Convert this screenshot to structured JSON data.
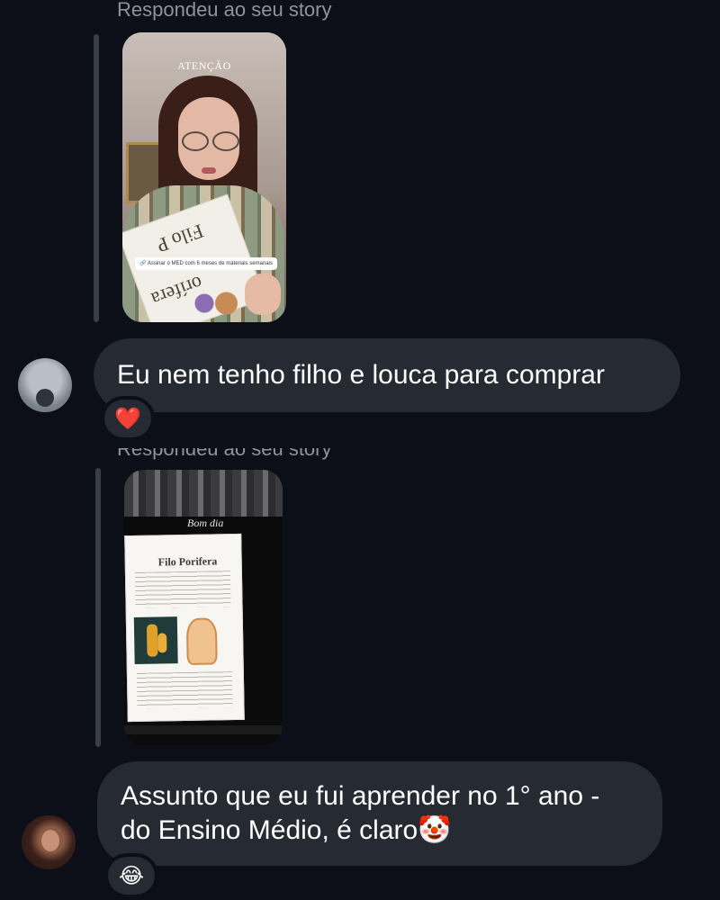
{
  "messages": [
    {
      "reply_label": "Respondeu ao seu story",
      "story": {
        "heading": "ATENÇÃO",
        "paper_text_1": "Filo P",
        "paper_text_2": "orífera",
        "sticker": "Assinar o MED com 6 meses de materiais semanais"
      },
      "text": "Eu nem tenho filho e louca para comprar",
      "reaction": "❤️"
    },
    {
      "reply_label": "Respondeu ao seu story",
      "story": {
        "heading": "Bom dia",
        "sheet_title": "Filo Porifera"
      },
      "text_line_1": "Assunto que eu fui aprender no 1° ano -",
      "text_line_2": "do Ensino Médio, é claro🤡",
      "reaction": "😂"
    }
  ],
  "colors": {
    "background": "#0c0f18",
    "bubble": "#262a32",
    "muted_text": "#8e939c"
  }
}
